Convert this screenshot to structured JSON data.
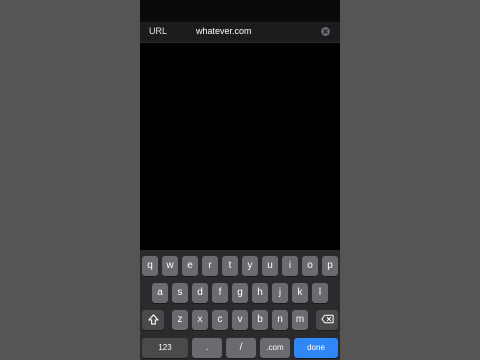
{
  "url_bar": {
    "label": "URL",
    "value": "whatever.com",
    "clear_icon": "clear-circle-icon"
  },
  "keyboard": {
    "row1": [
      "q",
      "w",
      "e",
      "r",
      "t",
      "y",
      "u",
      "i",
      "o",
      "p"
    ],
    "row2": [
      "a",
      "s",
      "d",
      "f",
      "g",
      "h",
      "j",
      "k",
      "l"
    ],
    "row3": [
      "z",
      "x",
      "c",
      "v",
      "b",
      "n",
      "m"
    ],
    "shift_icon": "shift-arrow-icon",
    "delete_icon": "backspace-icon",
    "numbers_label": "123",
    "dot_label": ".",
    "slash_label": "/",
    "com_label": ".com",
    "done_label": "done"
  },
  "colors": {
    "done_key": "#2f86f6",
    "key": "#6b6b6f",
    "keyboard_bg": "#2b2b2d"
  }
}
